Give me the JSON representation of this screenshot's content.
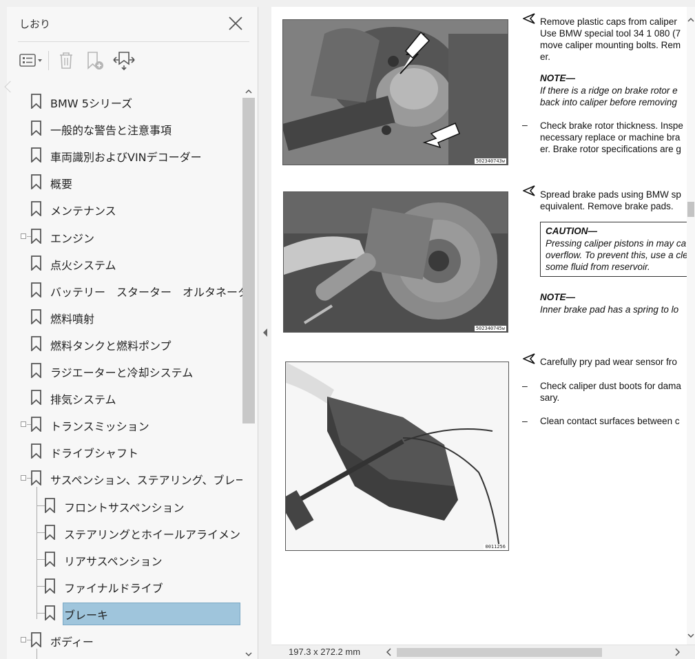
{
  "panel": {
    "title": "しおり"
  },
  "bookmarks": [
    {
      "label": "BMW 5シリーズ",
      "level": 0,
      "expandable": false
    },
    {
      "label": "一般的な警告と注意事項",
      "level": 0,
      "expandable": false
    },
    {
      "label": "車両識別およびVINデコーダー",
      "level": 0,
      "expandable": false
    },
    {
      "label": "概要",
      "level": 0,
      "expandable": false
    },
    {
      "label": "メンテナンス",
      "level": 0,
      "expandable": false
    },
    {
      "label": "エンジン",
      "level": 0,
      "expandable": true
    },
    {
      "label": "点火システム",
      "level": 0,
      "expandable": false
    },
    {
      "label": "バッテリー　スターター　オルタネーター",
      "level": 0,
      "expandable": false
    },
    {
      "label": "燃料噴射",
      "level": 0,
      "expandable": false
    },
    {
      "label": "燃料タンクと燃料ポンプ",
      "level": 0,
      "expandable": false
    },
    {
      "label": "ラジエーターと冷却システム",
      "level": 0,
      "expandable": false
    },
    {
      "label": "排気システム",
      "level": 0,
      "expandable": false
    },
    {
      "label": "トランスミッション",
      "level": 0,
      "expandable": true
    },
    {
      "label": "ドライブシャフト",
      "level": 0,
      "expandable": false
    },
    {
      "label": "サスペンション、ステアリング、ブレーキ全般",
      "level": 0,
      "expandable": true
    },
    {
      "label": "フロントサスペンション",
      "level": 1,
      "expandable": false
    },
    {
      "label": "ステアリングとホイールアライメント",
      "level": 1,
      "expandable": false
    },
    {
      "label": "リアサスペンション",
      "level": 1,
      "expandable": false
    },
    {
      "label": "ファイナルドライブ",
      "level": 1,
      "expandable": false
    },
    {
      "label": "ブレーキ",
      "level": 1,
      "expandable": false,
      "selected": true
    },
    {
      "label": "ボディー",
      "level": 0,
      "expandable": true
    }
  ],
  "doc": {
    "photo1_caption": "502340743w",
    "photo2_caption": "502340745w",
    "photo3_caption": "0011256",
    "step1": [
      "Remove plastic caps from caliper",
      "Use BMW special tool 34 1 080 (7",
      "move caliper mounting bolts. Rem",
      "er."
    ],
    "note1_head": "NOTE—",
    "note1": [
      "If there is a ridge on brake rotor e",
      "back into caliper before removing"
    ],
    "step1b": [
      "Check brake rotor thickness. Inspe",
      "necessary replace or machine bra",
      "er. Brake rotor specifications are g"
    ],
    "step2": [
      "Spread brake pads using BMW sp",
      "equivalent. Remove brake pads."
    ],
    "caution_head": "CAUTION—",
    "caution": [
      "Pressing caliper pistons in may ca",
      "overflow. To prevent this, use a cle",
      "some fluid from reservoir."
    ],
    "note2_head": "NOTE—",
    "note2": [
      "Inner brake pad has a spring to lo"
    ],
    "step3": [
      "Carefully pry pad wear sensor fro"
    ],
    "step3b": [
      "Check caliper dust boots for dama",
      "sary."
    ],
    "step3c": [
      "Clean contact surfaces between c"
    ],
    "dash": "–"
  },
  "status": {
    "page_size": "197.3 x 272.2 mm"
  },
  "colors": {
    "selection": "#9fc5dc",
    "panel_bg": "#f7f7f7"
  }
}
